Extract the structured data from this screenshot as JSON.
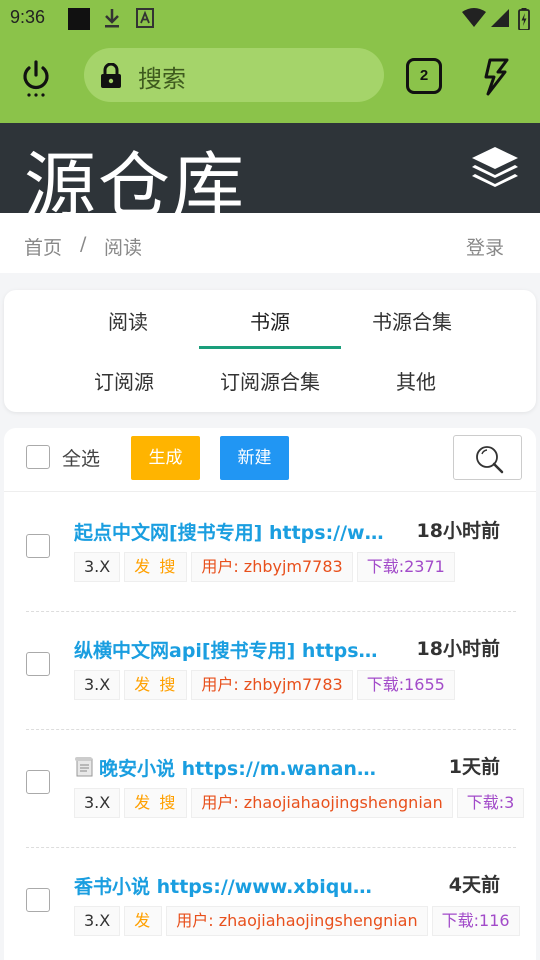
{
  "status_bar": {
    "time": "9:36",
    "icons": [
      "black-square-icon",
      "download-icon",
      "font-icon",
      "wifi-icon",
      "signal-icon",
      "battery-charging-icon"
    ]
  },
  "browser": {
    "search_placeholder": "搜索",
    "tab_count": "2",
    "accent": "#8bc34a"
  },
  "site": {
    "title": "源仓库",
    "header_bg": "#2e3439"
  },
  "breadcrumb": {
    "home": "首页",
    "separator": "/",
    "current": "阅读",
    "login": "登录"
  },
  "categories": {
    "row1": [
      "阅读",
      "书源",
      "书源合集"
    ],
    "row2": [
      "订阅源",
      "订阅源合集",
      "其他"
    ],
    "active": "书源"
  },
  "actions": {
    "select_all": "全选",
    "generate": "生成",
    "new": "新建"
  },
  "items": [
    {
      "title": "起点中文网[搜书专用] https://www.qidian.com",
      "time": "18小时前",
      "version": "3.X",
      "type": "发 搜",
      "user": "用户: zhbyjm7783",
      "downloads": "下载:2371",
      "has_icon": false
    },
    {
      "title": "纵横中文网api[搜书专用] https://www.zongheng.com",
      "time": "18小时前",
      "version": "3.X",
      "type": "发 搜",
      "user": "用户: zhbyjm7783",
      "downloads": "下载:1655",
      "has_icon": false
    },
    {
      "title": "晚安小说 https://m.wananxs.com",
      "time": "1天前",
      "version": "3.X",
      "type": "发 搜",
      "user": "用户: zhaojiahaojingshengnian",
      "downloads": "下载:3",
      "has_icon": true
    },
    {
      "title": "香书小说 https://www.xbiqugu.net",
      "time": "4天前",
      "version": "3.X",
      "type": "发",
      "user": "用户: zhaojiahaojingshengnian",
      "downloads": "下载:116",
      "has_icon": false
    }
  ],
  "colors": {
    "title_link": "#1a9ee0",
    "generate_btn": "#ffb400",
    "new_btn": "#2196f3",
    "active_tab_underline": "#1a9e7b",
    "user_tag": "#e8501c",
    "download_tag": "#a24bc9",
    "type_tag": "#ffa000"
  }
}
